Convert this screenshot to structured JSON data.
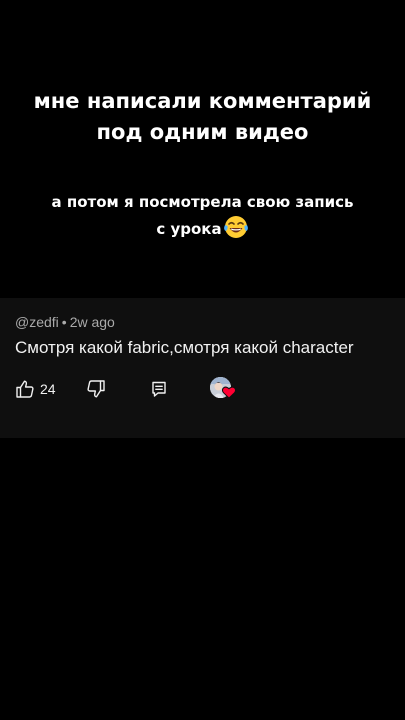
{
  "overlay": {
    "title_lines": [
      "мне написали комментарий",
      "под одним видео"
    ],
    "subtitle_line1": "а потом я посмотрела свою запись",
    "subtitle_line2": "с урока",
    "subtitle_emoji": "laughing-tears-emoji"
  },
  "comment": {
    "author": "@zedfi",
    "separator": "•",
    "time": "2w ago",
    "text": "Смотря какой fabric,смотря какой character",
    "like_count": "24"
  },
  "icons": {
    "like": "thumbs-up-icon",
    "dislike": "thumbs-down-icon",
    "reply": "reply-icon",
    "creator_heart": "heart-icon"
  },
  "colors": {
    "background": "#000000",
    "card": "#0f0f0f",
    "meta_text": "#aaaaaa",
    "primary_text": "#f1f1f1",
    "heart": "#ff0033"
  }
}
